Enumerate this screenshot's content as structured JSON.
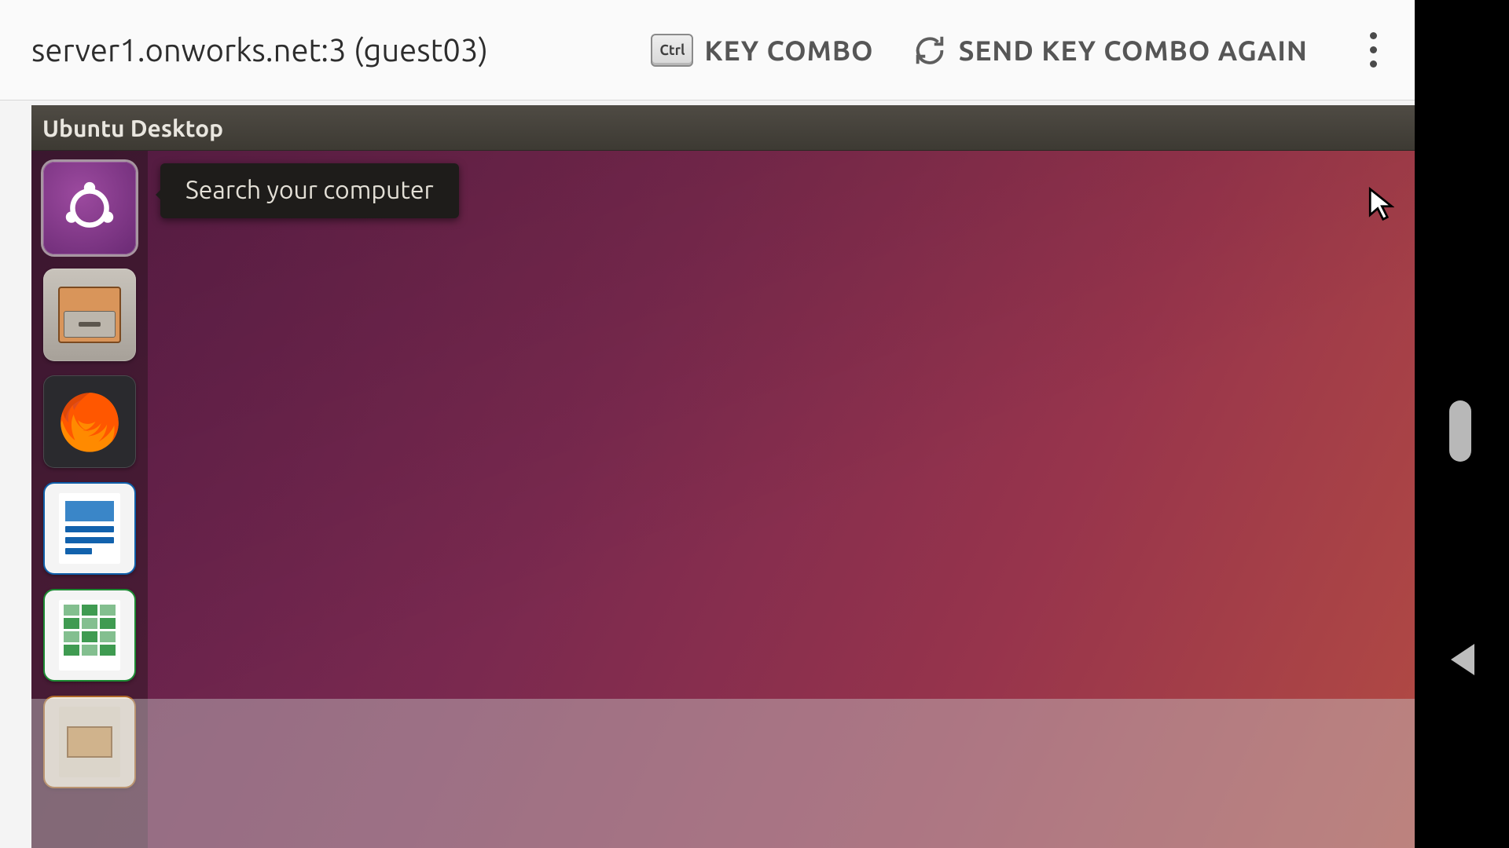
{
  "topbar": {
    "title": "server1.onworks.net:3 (guest03)",
    "ctrl_chip": "Ctrl",
    "key_combo_label": "KEY COMBO",
    "send_again_label": "SEND KEY COMBO AGAIN"
  },
  "ubuntu": {
    "panel_title": "Ubuntu Desktop",
    "tooltip": "Search your computer",
    "launcher": [
      {
        "id": "dash",
        "name": "Search your computer",
        "active": true
      },
      {
        "id": "files",
        "name": "Files",
        "active": false
      },
      {
        "id": "firefox",
        "name": "Firefox Web Browser",
        "active": false
      },
      {
        "id": "writer",
        "name": "LibreOffice Writer",
        "active": false
      },
      {
        "id": "calc",
        "name": "LibreOffice Calc",
        "active": false
      },
      {
        "id": "impress",
        "name": "LibreOffice Impress",
        "active": false
      }
    ]
  }
}
